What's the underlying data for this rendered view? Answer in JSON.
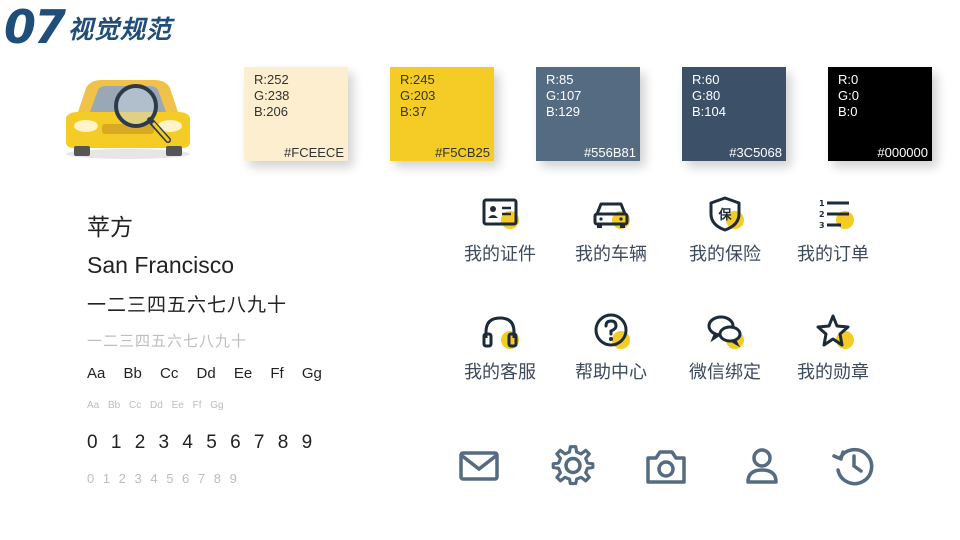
{
  "header": {
    "number": "07",
    "title": "视觉规范"
  },
  "swatches": [
    {
      "r": "R:252",
      "g": "G:238",
      "b": "B:206",
      "hex": "#FCEECE",
      "bg": "#FCEECE",
      "fg": "#333333"
    },
    {
      "r": "R:245",
      "g": "G:203",
      "b": "B:37",
      "hex": "#F5CB25",
      "bg": "#F5CB25",
      "fg": "#333333"
    },
    {
      "r": "R:85",
      "g": "G:107",
      "b": "B:129",
      "hex": "#556B81",
      "bg": "#556B81",
      "fg": "#ffffff"
    },
    {
      "r": "R:60",
      "g": "G:80",
      "b": "B:104",
      "hex": "#3C5068",
      "bg": "#3C5068",
      "fg": "#ffffff"
    },
    {
      "r": "R:0",
      "g": "G:0",
      "b": "B:0",
      "hex": "#000000",
      "bg": "#000000",
      "fg": "#ffffff"
    }
  ],
  "typography": {
    "font_cn": "苹方",
    "font_en": "San Francisco",
    "numerals_cn": "一二三四五六七八九十",
    "numerals_cn_light": "一二三四五六七八九十",
    "letters": "Aa Bb Cc Dd Ee Ff Gg",
    "letters_light": "Aa Bb Cc Dd Ee Ff Gg",
    "digits": "0 1 2 3 4 5 6 7 8 9",
    "digits_light": "0 1 2 3 4 5 6 7 8 9"
  },
  "features": [
    {
      "label": "我的证件",
      "icon": "id-card-icon"
    },
    {
      "label": "我的车辆",
      "icon": "car-icon"
    },
    {
      "label": "我的保险",
      "icon": "insurance-shield-icon"
    },
    {
      "label": "我的订单",
      "icon": "order-list-icon"
    },
    {
      "label": "我的客服",
      "icon": "headset-icon"
    },
    {
      "label": "帮助中心",
      "icon": "help-question-icon"
    },
    {
      "label": "微信绑定",
      "icon": "wechat-chat-icon"
    },
    {
      "label": "我的勋章",
      "icon": "star-medal-icon"
    }
  ],
  "bottom_icons": [
    "mail-icon",
    "settings-gear-icon",
    "camera-icon",
    "user-icon",
    "history-icon"
  ],
  "colors": {
    "accent": "#F5CB25",
    "icon_dark": "#1d2a3a",
    "icon_slate": "#556B81",
    "brand_blue": "#1f4e7a"
  }
}
